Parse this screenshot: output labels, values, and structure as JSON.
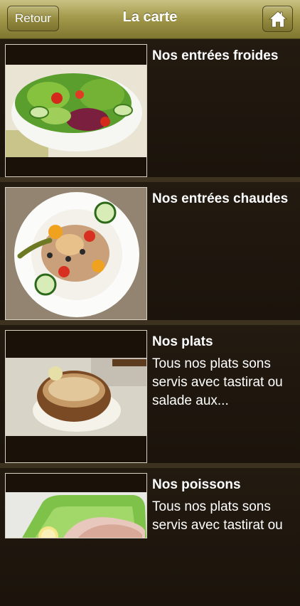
{
  "navbar": {
    "title": "La carte",
    "back_label": "Retour",
    "home_icon": "home-icon"
  },
  "menu": {
    "items": [
      {
        "title": "Nos entrées froides",
        "description": "",
        "image": "green-salad"
      },
      {
        "title": "Nos entrées chaudes",
        "description": "",
        "image": "warm-salad-plate"
      },
      {
        "title": "Nos plats",
        "description": "Tous nos plats sons servis avec tastirat ou salade aux...",
        "image": "tagine-dish"
      },
      {
        "title": "Nos poissons",
        "description": "Tous nos plats sons servis avec tastirat ou salade aux...",
        "image": "fish-on-tray"
      }
    ]
  },
  "colors": {
    "navbar": "#a49a4c",
    "row_background": "#1f170e",
    "separator": "#3d3120",
    "text": "#ffffff"
  }
}
